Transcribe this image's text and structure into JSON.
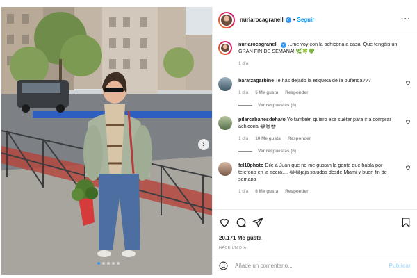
{
  "post": {
    "username": "nuriarocagranell",
    "follow_label": "Seguir",
    "more_label": "···",
    "caption": {
      "username": "nuriarocagranell",
      "text": "...me voy con la achicoria a casa! Que tengáis un GRAN FIN DE SEMANA! 🌿🍀💚",
      "time": "1 día"
    },
    "comments": [
      {
        "username": "baratzagarbine",
        "text": "Te has dejado la etiqueta de la bufanda???",
        "time": "1 día",
        "likes": "5 Me gusta",
        "reply_label": "Responder",
        "view_replies": "Ver respuestas (6)"
      },
      {
        "username": "pilarcabanesdeharo",
        "text": "Yo también quiero ese suéter para ir a comprar achicoria 😂😍😍",
        "time": "1 día",
        "likes": "10 Me gusta",
        "reply_label": "Responder",
        "view_replies": "Ver respuestas (6)"
      },
      {
        "username": "fel10photo",
        "text": "Dile a Juan que no me gustan la gente que habla por teléfono en la acera.... 😂😂jaja saludos desde Miami y buen fin de semana",
        "time": "1 día",
        "likes": "8 Me gusta",
        "reply_label": "Responder"
      }
    ],
    "likes_count": "20.171 Me gusta",
    "time_ago": "HACE UN DÍA",
    "comment_placeholder": "Añade un comentario...",
    "publish_label": "Publicar",
    "carousel": {
      "total": 5,
      "active": 1
    },
    "colors": {
      "accent": "#0095f6",
      "verified": "#3897f0",
      "muted": "#8e8e8e"
    }
  }
}
